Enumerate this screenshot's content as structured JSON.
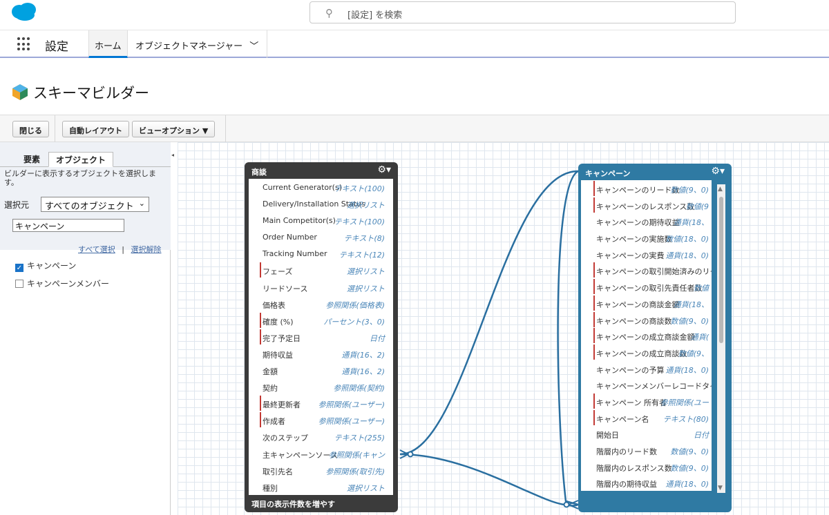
{
  "header": {
    "search_placeholder": "[設定] を検索",
    "app_name": "設定",
    "tabs": [
      {
        "label": "ホーム"
      },
      {
        "label": "オブジェクトマネージャー"
      }
    ]
  },
  "page": {
    "title": "スキーマビルダー"
  },
  "toolbar": {
    "close": "閉じる",
    "auto_layout": "自動レイアウト",
    "view_options": "ビューオプション ▼"
  },
  "left_panel": {
    "tab_elements": "要素",
    "tab_objects": "オブジェクト",
    "description": "ビルダーに表示するオブジェクトを選択します。",
    "select_label": "選択元",
    "select_value": "すべてのオブジェクト",
    "filter_value": "キャンペーン",
    "select_all": "すべて選択",
    "separator": "|",
    "deselect": "選択解除",
    "objects": [
      {
        "label": "キャンペーン",
        "checked": true
      },
      {
        "label": "キャンペーンメンバー",
        "checked": false
      }
    ]
  },
  "deal_object": {
    "title": "商談",
    "footer": "項目の表示件数を増やす",
    "fields": [
      {
        "name": "Current Generator(s)",
        "type": "テキスト(100)",
        "required": false
      },
      {
        "name": "Delivery/Installation Status",
        "type": "選択リスト",
        "required": false
      },
      {
        "name": "Main Competitor(s)",
        "type": "テキスト(100)",
        "required": false
      },
      {
        "name": "Order Number",
        "type": "テキスト(8)",
        "required": false
      },
      {
        "name": "Tracking Number",
        "type": "テキスト(12)",
        "required": false
      },
      {
        "name": "フェーズ",
        "type": "選択リスト",
        "required": true
      },
      {
        "name": "リードソース",
        "type": "選択リスト",
        "required": false
      },
      {
        "name": "価格表",
        "type": "参照関係(価格表)",
        "required": false
      },
      {
        "name": "確度 (%)",
        "type": "パーセント(3、0)",
        "required": true
      },
      {
        "name": "完了予定日",
        "type": "日付",
        "required": true
      },
      {
        "name": "期待収益",
        "type": "通貨(16、2)",
        "required": false
      },
      {
        "name": "金額",
        "type": "通貨(16、2)",
        "required": false
      },
      {
        "name": "契約",
        "type": "参照関係(契約)",
        "required": false
      },
      {
        "name": "最終更新者",
        "type": "参照関係(ユーザー)",
        "required": true
      },
      {
        "name": "作成者",
        "type": "参照関係(ユーザー)",
        "required": true
      },
      {
        "name": "次のステップ",
        "type": "テキスト(255)",
        "required": false
      },
      {
        "name": "主キャンペーンソース",
        "type": "参照関係(キャン",
        "required": false
      },
      {
        "name": "取引先名",
        "type": "参照関係(取引先)",
        "required": false
      },
      {
        "name": "種別",
        "type": "選択リスト",
        "required": false
      }
    ]
  },
  "campaign_object": {
    "title": "キャンペーン",
    "fields": [
      {
        "name": "キャンペーンのリード数",
        "type": "数値(9、0)",
        "required": true
      },
      {
        "name": "キャンペーンのレスポンス数",
        "type": "数値(9",
        "required": true
      },
      {
        "name": "キャンペーンの期待収益",
        "type": "通貨(18、",
        "required": false
      },
      {
        "name": "キャンペーンの実施数",
        "type": "数値(18、0)",
        "required": false
      },
      {
        "name": "キャンペーンの実費",
        "type": "通貨(18、0)",
        "required": false
      },
      {
        "name": "キャンペーンの取引開始済みのリー",
        "type": "",
        "required": true
      },
      {
        "name": "キャンペーンの取引先責任者数",
        "type": "数値",
        "required": true
      },
      {
        "name": "キャンペーンの商談金額",
        "type": "通貨(18、",
        "required": true
      },
      {
        "name": "キャンペーンの商談数",
        "type": "数値(9、0)",
        "required": true
      },
      {
        "name": "キャンペーンの成立商談金額",
        "type": "通貨(",
        "required": true
      },
      {
        "name": "キャンペーンの成立商談数",
        "type": "数値(9、",
        "required": true
      },
      {
        "name": "キャンペーンの予算",
        "type": "通貨(18、0)",
        "required": false
      },
      {
        "name": "キャンペーンメンバーレコードタイ",
        "type": "",
        "required": false
      },
      {
        "name": "キャンペーン 所有者",
        "type": "参照関係(ユー",
        "required": true
      },
      {
        "name": "キャンペーン名",
        "type": "テキスト(80)",
        "required": true
      },
      {
        "name": "開始日",
        "type": "日付",
        "required": false
      },
      {
        "name": "階層内のリード数",
        "type": "数値(9、0)",
        "required": false
      },
      {
        "name": "階層内のレスポンス数",
        "type": "数値(9、0)",
        "required": false
      },
      {
        "name": "階層内の期待収益",
        "type": "通貨(18、0)",
        "required": false
      }
    ]
  },
  "colors": {
    "deal_header": "#3b3b3b",
    "campaign_header": "#2f7aa3",
    "required_marker": "#c23934",
    "relation_line": "#2a6fa0"
  }
}
